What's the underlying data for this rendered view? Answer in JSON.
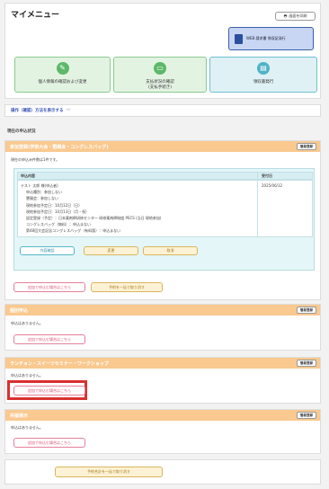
{
  "menu": {
    "title": "マイメニュー",
    "print_label": "画面を印刷",
    "web_invoice_label": "WEB 請求書 領収証発行",
    "tiles": [
      {
        "label_line1": "個人情報の確認および変更",
        "label_line2": ""
      },
      {
        "label_line1": "支払状況の確認",
        "label_line2": "(支払手続き)"
      },
      {
        "label_line1": "領収書発行",
        "label_line2": ""
      }
    ]
  },
  "operation_link": "操作（確認）方法を表示する",
  "status_heading": "現在の申込状況",
  "sections": {
    "participation": {
      "header": "参加登録(学術大会・懇親会・コングレスバッグ)",
      "tag": "簡易登録",
      "count_text": "現在の申込み件数は1件です。",
      "table": {
        "col_content": "申込内容",
        "col_date": "受付日",
        "date": "2025/06/12",
        "lines": [
          "テスト 太郎 様(申込者)",
          "申込種別：参加しない",
          "懇親会：参加しない",
          "現地参加予定日：10月12日（日）",
          "現地参加予定日：10月13日（月・祝）",
          "認定登録（予定）：日本薬剤師研修センター 研修薬剤師制度 PECS (当日 現地参加)",
          "コングレスバッグ（無料）：申込まない",
          "第48回大会記念コングレスバッグ（有料版）：申込まない"
        ]
      },
      "btn_detail": "内容確認",
      "btn_change": "変更",
      "btn_cancel": "取消",
      "btn_add": "追加で申込む場合はこちら",
      "btn_reserve": "予約を一括で取り消す"
    },
    "seminar": {
      "header": "個別申込",
      "tag": "簡易登録",
      "none_text": "申込はありません。",
      "btn_add": "追加で申込む場合はこちら"
    },
    "luncheon": {
      "header": "ランチョン・スイーツセミナー・ワークショップ",
      "tag": "簡易登録",
      "none_text": "申込はありません。",
      "btn_add": "追加で申込む場合はこちら"
    },
    "other": {
      "header": "共催展示",
      "tag": "簡易登録",
      "none_text": "申込はありません。",
      "btn_add": "追加で申込む場合はこちら"
    }
  },
  "footer_btn": "予約合計を一括で取り消す",
  "colors": {
    "section_header": "#f9c98f",
    "highlight_box": "#d93030",
    "tile_green": "#5db86a",
    "tile_teal": "#4fb3c6",
    "web_box": "#c8d6f4"
  }
}
